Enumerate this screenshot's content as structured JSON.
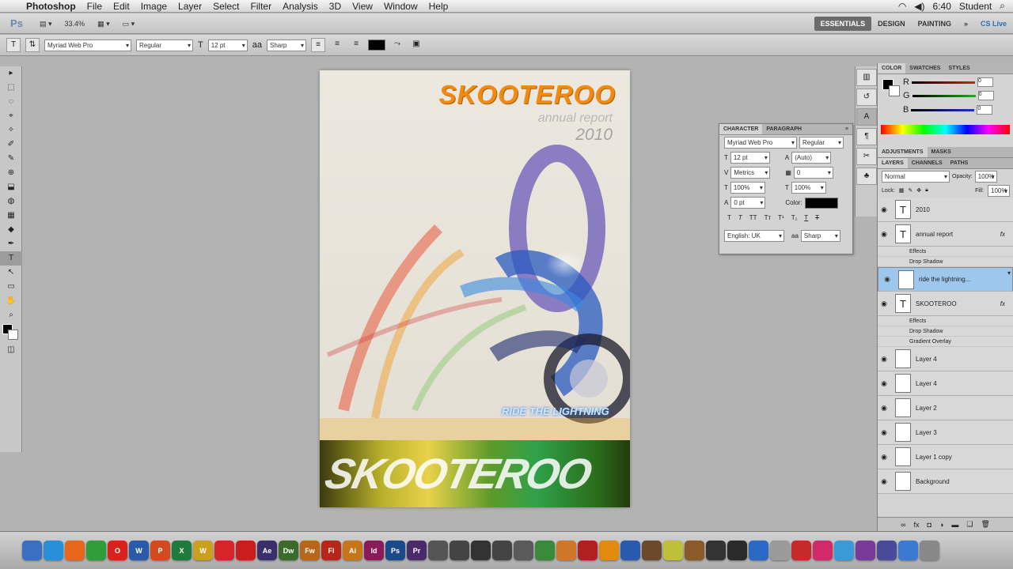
{
  "menubar": {
    "app": "Photoshop",
    "items": [
      "File",
      "Edit",
      "Image",
      "Layer",
      "Select",
      "Filter",
      "Analysis",
      "3D",
      "View",
      "Window",
      "Help"
    ],
    "clock": "6:40",
    "user": "Student"
  },
  "appbar": {
    "logo": "Ps",
    "zoom": "33.4%",
    "workspaces": [
      "ESSENTIALS",
      "DESIGN",
      "PAINTING"
    ],
    "more": "»",
    "cslive": "CS Live"
  },
  "options": {
    "font_family": "Myriad Web Pro",
    "font_style": "Regular",
    "size": "12 pt",
    "aa_label": "aa",
    "antialias": "Sharp"
  },
  "tools": [
    "▸",
    "⬚",
    "◌",
    "⌖",
    "✧",
    "✐",
    "✎",
    "⊕",
    "⬓",
    "◍",
    "▦",
    "◆",
    "✒",
    "T",
    "↖",
    "▭",
    "✋",
    "⌕"
  ],
  "document": {
    "title": "SKOOTEROO",
    "subtitle": "annual report",
    "year": "2010",
    "tagline": "RIDE THE LIGHTNING",
    "bottom_text": "SKOOTEROO"
  },
  "character_panel": {
    "tabs": [
      "CHARACTER",
      "PARAGRAPH"
    ],
    "font_family": "Myriad Web Pro",
    "font_style": "Regular",
    "size": "12 pt",
    "leading": "(Auto)",
    "kerning": "Metrics",
    "tracking": "0",
    "vscale": "100%",
    "hscale": "100%",
    "baseline": "0 pt",
    "color_label": "Color:",
    "language": "English: UK",
    "aa_label": "aa",
    "antialias": "Sharp"
  },
  "color_panel": {
    "tabs": [
      "COLOR",
      "SWATCHES",
      "STYLES"
    ],
    "channels": [
      {
        "label": "R",
        "color": "#d42020",
        "value": "0"
      },
      {
        "label": "G",
        "color": "#20b020",
        "value": "0"
      },
      {
        "label": "B",
        "color": "#2030d0",
        "value": "0"
      }
    ]
  },
  "adjust_tabs": [
    "ADJUSTMENTS",
    "MASKS"
  ],
  "layers_panel": {
    "tabs": [
      "LAYERS",
      "CHANNELS",
      "PATHS"
    ],
    "blend_mode": "Normal",
    "opacity_label": "Opacity:",
    "opacity": "100%",
    "lock_label": "Lock:",
    "fill_label": "Fill:",
    "fill": "100%",
    "layers": [
      {
        "type": "text",
        "name": "2010",
        "fx": "",
        "effects": []
      },
      {
        "type": "text",
        "name": "annual report",
        "fx": "fx",
        "effects": [
          "Effects",
          "Drop Shadow"
        ]
      },
      {
        "type": "image",
        "name": "ride the lightning...",
        "fx": "",
        "effects": [],
        "selected": true
      },
      {
        "type": "text",
        "name": "SKOOTEROO",
        "fx": "fx",
        "effects": [
          "Effects",
          "Drop Shadow",
          "Gradient Overlay"
        ]
      },
      {
        "type": "image",
        "name": "Layer 4",
        "fx": "",
        "effects": []
      },
      {
        "type": "image",
        "name": "Layer 4",
        "fx": "",
        "effects": []
      },
      {
        "type": "image",
        "name": "Layer 2",
        "fx": "",
        "effects": []
      },
      {
        "type": "image",
        "name": "Layer 3",
        "fx": "",
        "effects": []
      },
      {
        "type": "image",
        "name": "Layer 1 copy",
        "fx": "",
        "effects": []
      },
      {
        "type": "image",
        "name": "Background",
        "fx": "",
        "effects": []
      }
    ]
  },
  "dock": [
    {
      "label": "",
      "color": "#3a6fc4"
    },
    {
      "label": "",
      "color": "#2a8fd9"
    },
    {
      "label": "",
      "color": "#e8661c"
    },
    {
      "label": "",
      "color": "#2f9e3a"
    },
    {
      "label": "O",
      "color": "#d9221c"
    },
    {
      "label": "W",
      "color": "#2a5aa8"
    },
    {
      "label": "P",
      "color": "#d24b1f"
    },
    {
      "label": "X",
      "color": "#1f7a3b"
    },
    {
      "label": "W",
      "color": "#c9a020"
    },
    {
      "label": "",
      "color": "#d6242a"
    },
    {
      "label": "",
      "color": "#c81e1e"
    },
    {
      "label": "Ae",
      "color": "#3a2f6b"
    },
    {
      "label": "Dw",
      "color": "#3a6b2a"
    },
    {
      "label": "Fw",
      "color": "#b8661a"
    },
    {
      "label": "Fl",
      "color": "#b8261a"
    },
    {
      "label": "Ai",
      "color": "#c7741a"
    },
    {
      "label": "Id",
      "color": "#8a1a5a"
    },
    {
      "label": "Ps",
      "color": "#1a4a8a"
    },
    {
      "label": "Pr",
      "color": "#4a2a6a"
    },
    {
      "label": "",
      "color": "#555"
    },
    {
      "label": "",
      "color": "#444"
    },
    {
      "label": "",
      "color": "#333"
    },
    {
      "label": "",
      "color": "#444"
    },
    {
      "label": "",
      "color": "#5a5a5a"
    },
    {
      "label": "",
      "color": "#3a8a3a"
    },
    {
      "label": "",
      "color": "#d0762a"
    },
    {
      "label": "",
      "color": "#b02020"
    },
    {
      "label": "",
      "color": "#e08a10"
    },
    {
      "label": "",
      "color": "#2a5ab0"
    },
    {
      "label": "",
      "color": "#6a4a2a"
    },
    {
      "label": "",
      "color": "#bfbf3a"
    },
    {
      "label": "",
      "color": "#8a5a2a"
    },
    {
      "label": "",
      "color": "#333"
    },
    {
      "label": "",
      "color": "#2a2a2a"
    },
    {
      "label": "",
      "color": "#2a6ac4"
    },
    {
      "label": "",
      "color": "#9a9a9a"
    },
    {
      "label": "",
      "color": "#c62a2a"
    },
    {
      "label": "",
      "color": "#d02a6a"
    },
    {
      "label": "",
      "color": "#3a9ad8"
    },
    {
      "label": "",
      "color": "#7a3a9a"
    },
    {
      "label": "",
      "color": "#4a4a9a"
    },
    {
      "label": "",
      "color": "#3a7ad0"
    },
    {
      "label": "",
      "color": "#888"
    }
  ]
}
